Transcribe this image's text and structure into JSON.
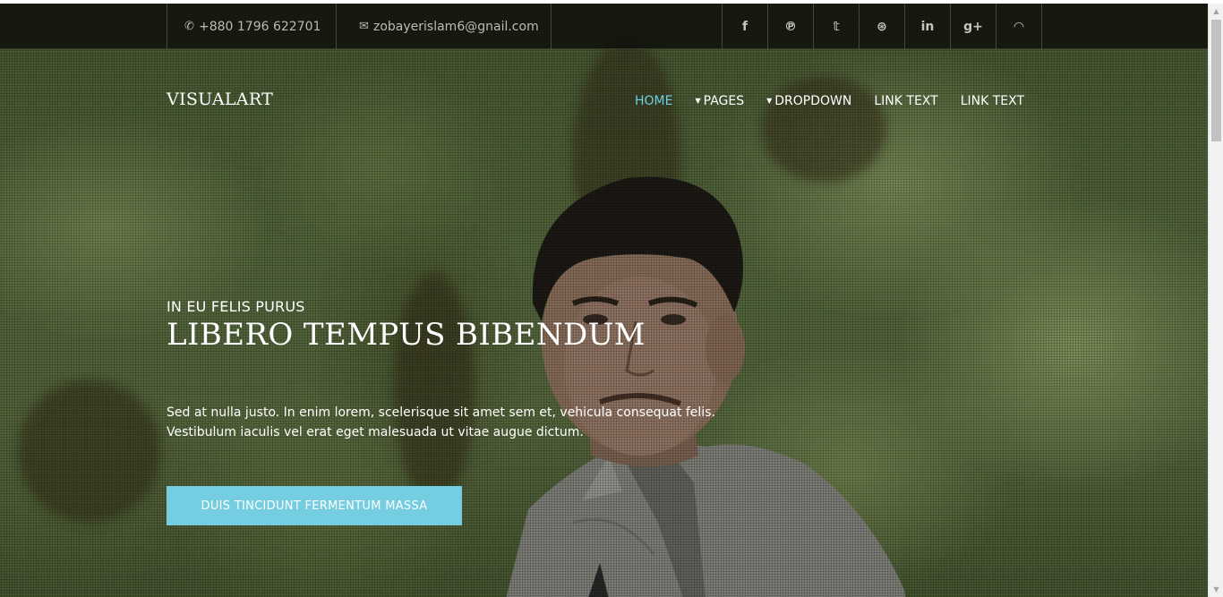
{
  "topbar": {
    "phone": "+880 1796 622701",
    "email": "zobayerislam6@gnail.com",
    "phone_icon": "phone-icon",
    "email_icon": "envelope-icon",
    "socials": [
      {
        "name": "facebook-icon",
        "glyph": "f"
      },
      {
        "name": "pinterest-icon",
        "glyph": "℗"
      },
      {
        "name": "twitter-icon",
        "glyph": "𝕥"
      },
      {
        "name": "dribbble-icon",
        "glyph": "⊛"
      },
      {
        "name": "linkedin-icon",
        "glyph": "in"
      },
      {
        "name": "google-plus-icon",
        "glyph": "g+"
      },
      {
        "name": "rss-icon",
        "glyph": "◠"
      }
    ]
  },
  "brand": "VISUALART",
  "nav": {
    "home": "HOME",
    "pages": "PAGES",
    "dropdown": "DROPDOWN",
    "link1": "LINK TEXT",
    "link2": "LINK TEXT",
    "active_color": "#6fcfe0"
  },
  "hero": {
    "kicker": "IN EU FELIS PURUS",
    "headline": "LIBERO TEMPUS BIBENDUM",
    "description": "Sed at nulla justo. In enim lorem, scelerisque sit amet sem et, vehicula consequat felis. Vestibulum iaculis vel erat eget malesuada ut vitae augue dictum.",
    "cta": "DUIS TINCIDUNT FERMENTUM MASSA",
    "cta_color": "#74cde0"
  }
}
